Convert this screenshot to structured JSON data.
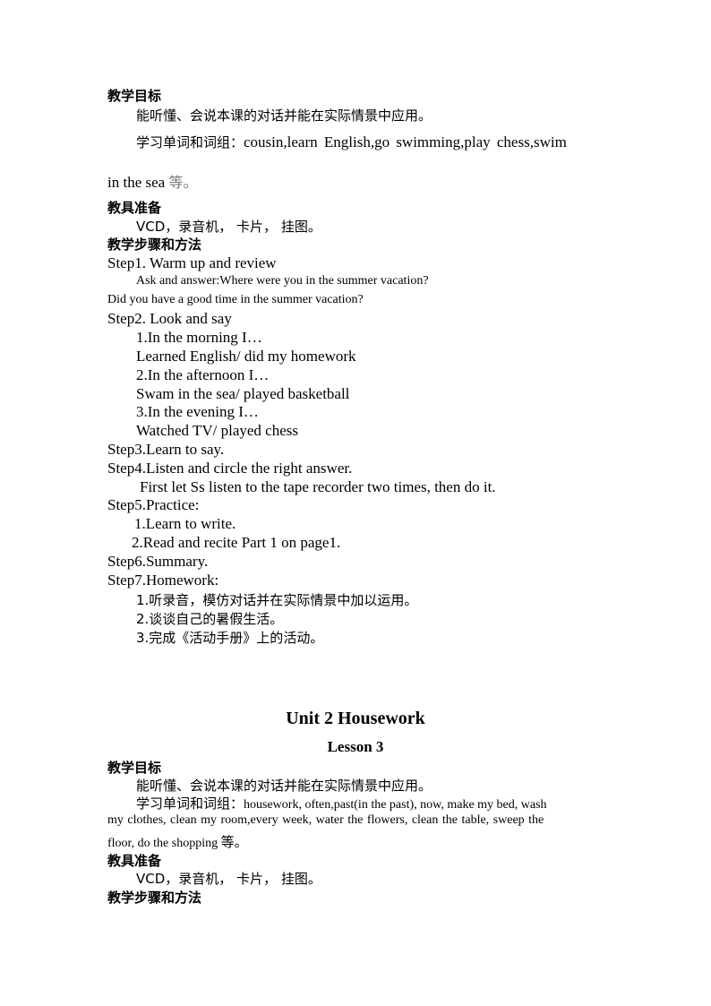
{
  "section1": {
    "objectives_heading": "教学目标",
    "objectives_line1": "能听懂、会说本课的对话并能在实际情景中应用。",
    "vocab_label": "学习单词和词组：",
    "vocab_text": "cousin,learn English,go swimming,play chess,swim",
    "vocab_cont": "in the sea ",
    "vocab_etc": "等。",
    "materials_heading": "教具准备",
    "materials_text": "VCD，录音机， 卡片， 挂图。",
    "steps_heading": "教学步骤和方法",
    "steps": {
      "step1": "Step1. Warm up and review",
      "step1_q1": "Ask and answer:Where were you in the summer vacation?",
      "step1_q2": "Did you have a good time in the summer vacation?",
      "step2": "Step2. Look and say",
      "step2_items": [
        "1.In the morning I…",
        "Learned English/ did my homework",
        "2.In the afternoon I…",
        "Swam in the sea/ played basketball",
        "3.In the evening I…",
        "Watched TV/ played chess"
      ],
      "step3": "Step3.Learn to say.",
      "step4": "Step4.Listen and circle the right answer.",
      "step4_detail": "First let Ss listen to the tape recorder two times, then do it.",
      "step5": "Step5.Practice:",
      "step5_items": [
        "1.Learn to write.",
        "2.Read and recite Part 1 on page1."
      ],
      "step6": "Step6.Summary.",
      "step7": "Step7.Homework:",
      "step7_items": [
        "1.听录音，模仿对话并在实际情景中加以运用。",
        "2.谈谈自己的暑假生活。",
        "3.完成《活动手册》上的活动。"
      ]
    }
  },
  "section2": {
    "unit_title": "Unit 2 Housework",
    "lesson_title": "Lesson 3",
    "objectives_heading": "教学目标",
    "objectives_line1": "能听懂、会说本课的对话并能在实际情景中应用。",
    "vocab_label": "学习单词和词组：",
    "vocab_line1": "housework, often,past(in the past), now, make my bed, wash",
    "vocab_line2": "my clothes, clean my room,every week, water the flowers, clean the table, sweep the",
    "vocab_line3": "floor, do the shopping ",
    "vocab_etc": "等。",
    "materials_heading": "教具准备",
    "materials_text": "VCD，录音机， 卡片， 挂图。",
    "steps_heading": "教学步骤和方法"
  }
}
